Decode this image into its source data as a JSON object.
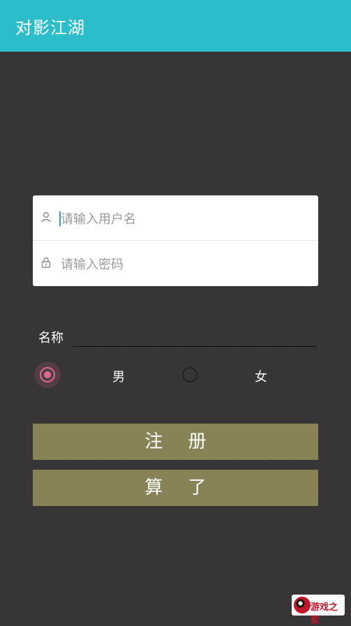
{
  "appbar": {
    "title": "对影江湖"
  },
  "login": {
    "username_placeholder": "请输入用户名",
    "password_placeholder": "请输入密码"
  },
  "profile": {
    "name_label": "名称",
    "name_value": "",
    "gender_male": "男",
    "gender_female": "女",
    "selected_gender": "男"
  },
  "buttons": {
    "register": "注 册",
    "cancel": "算 了"
  },
  "watermark": {
    "text": "游戏之家"
  },
  "colors": {
    "appbar": "#2cbdcb",
    "background": "#373536",
    "button": "#878356",
    "radio_accent": "#d96b8e"
  }
}
